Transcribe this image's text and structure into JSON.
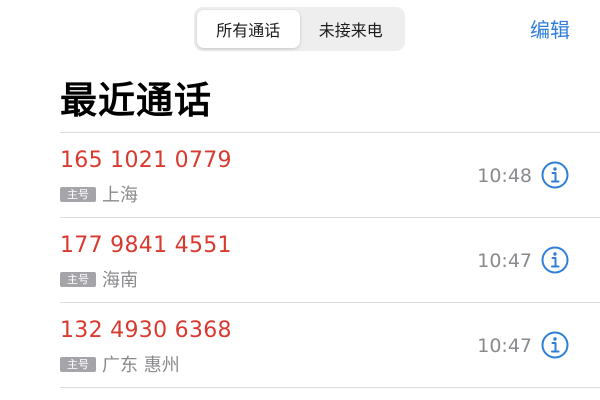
{
  "header": {
    "tabs": [
      {
        "label": "所有通话",
        "active": true
      },
      {
        "label": "未接来电",
        "active": false
      }
    ],
    "edit_label": "编辑",
    "title": "最近通话"
  },
  "calls": [
    {
      "number": "165 1021 0779",
      "tag": "主号",
      "location": "上海",
      "time": "10:48",
      "info_icon": "info-circle-icon"
    },
    {
      "number": "177 9841 4551",
      "tag": "主号",
      "location": "海南",
      "time": "10:47",
      "info_icon": "info-circle-icon"
    },
    {
      "number": "132 4930 6368",
      "tag": "主号",
      "location": "广东 惠州",
      "time": "10:47",
      "info_icon": "info-circle-icon"
    }
  ],
  "colors": {
    "missed_call": "#d93a30",
    "accent": "#2f7ed8",
    "secondary_text": "#8a8a8e"
  }
}
